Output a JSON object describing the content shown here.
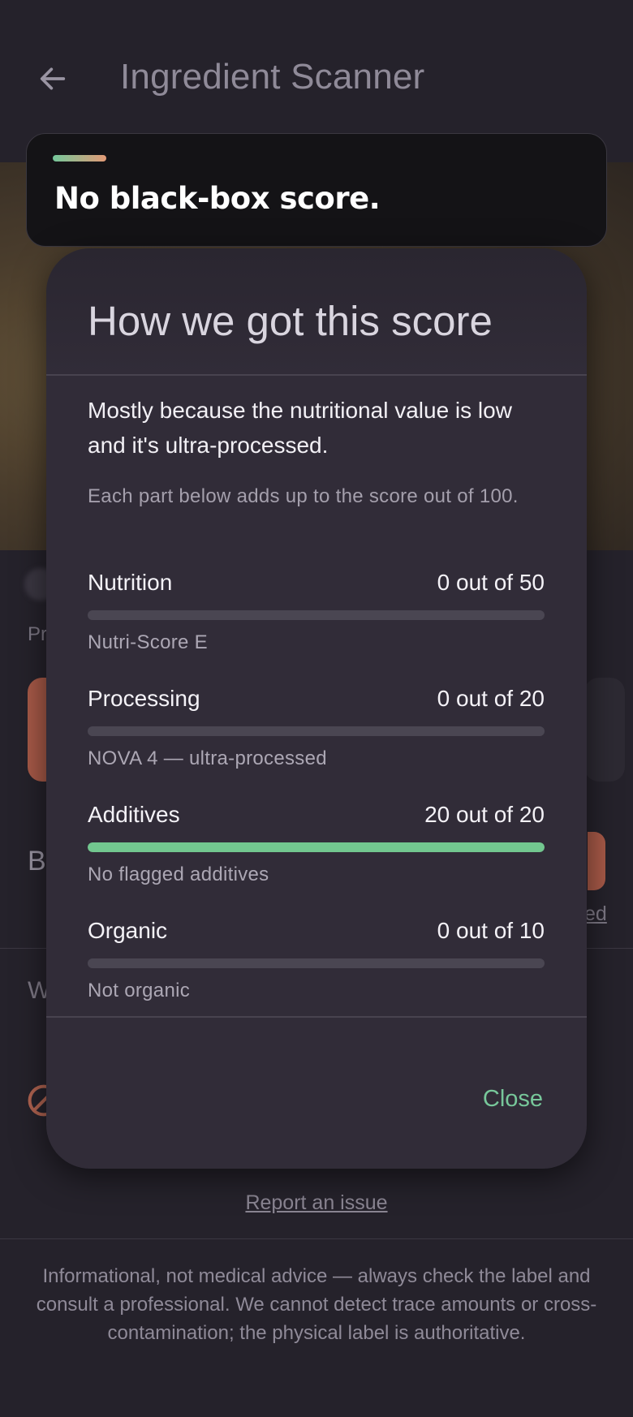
{
  "appbar": {
    "title": "Ingredient Scanner",
    "back_icon": "arrow-left-icon"
  },
  "background_fragments": {
    "left_label_1": "Pr",
    "left_label_2": "B",
    "left_label_3": "W",
    "right_link": "ed"
  },
  "snackbar": {
    "message": "No black-box score."
  },
  "dialog": {
    "title": "How we got this score",
    "summary": "Mostly because the nutritional value is low and it's ultra-processed.",
    "hint": "Each part below adds up to the score out of 100.",
    "parts": [
      {
        "label": "Nutrition",
        "value": "0 out of 50",
        "fill": 0.0,
        "note": "Nutri-Score E"
      },
      {
        "label": "Processing",
        "value": "0 out of 20",
        "fill": 0.0,
        "note": "NOVA 4 — ultra-processed"
      },
      {
        "label": "Additives",
        "value": "20 out of 20",
        "fill": 1.0,
        "note": "No flagged additives"
      },
      {
        "label": "Organic",
        "value": "0 out of 10",
        "fill": 0.0,
        "note": "Not organic"
      }
    ],
    "close_label": "Close"
  },
  "footer": {
    "report_link": "Report an issue",
    "disclaimer": "Informational, not medical advice — always check the label and consult a professional. We cannot detect trace amounts or cross-contamination; the physical label is authoritative."
  },
  "colors": {
    "accent_green": "#72c78f",
    "accent_coral": "#e39a76",
    "surface": "#312c38",
    "background": "#25222b"
  }
}
